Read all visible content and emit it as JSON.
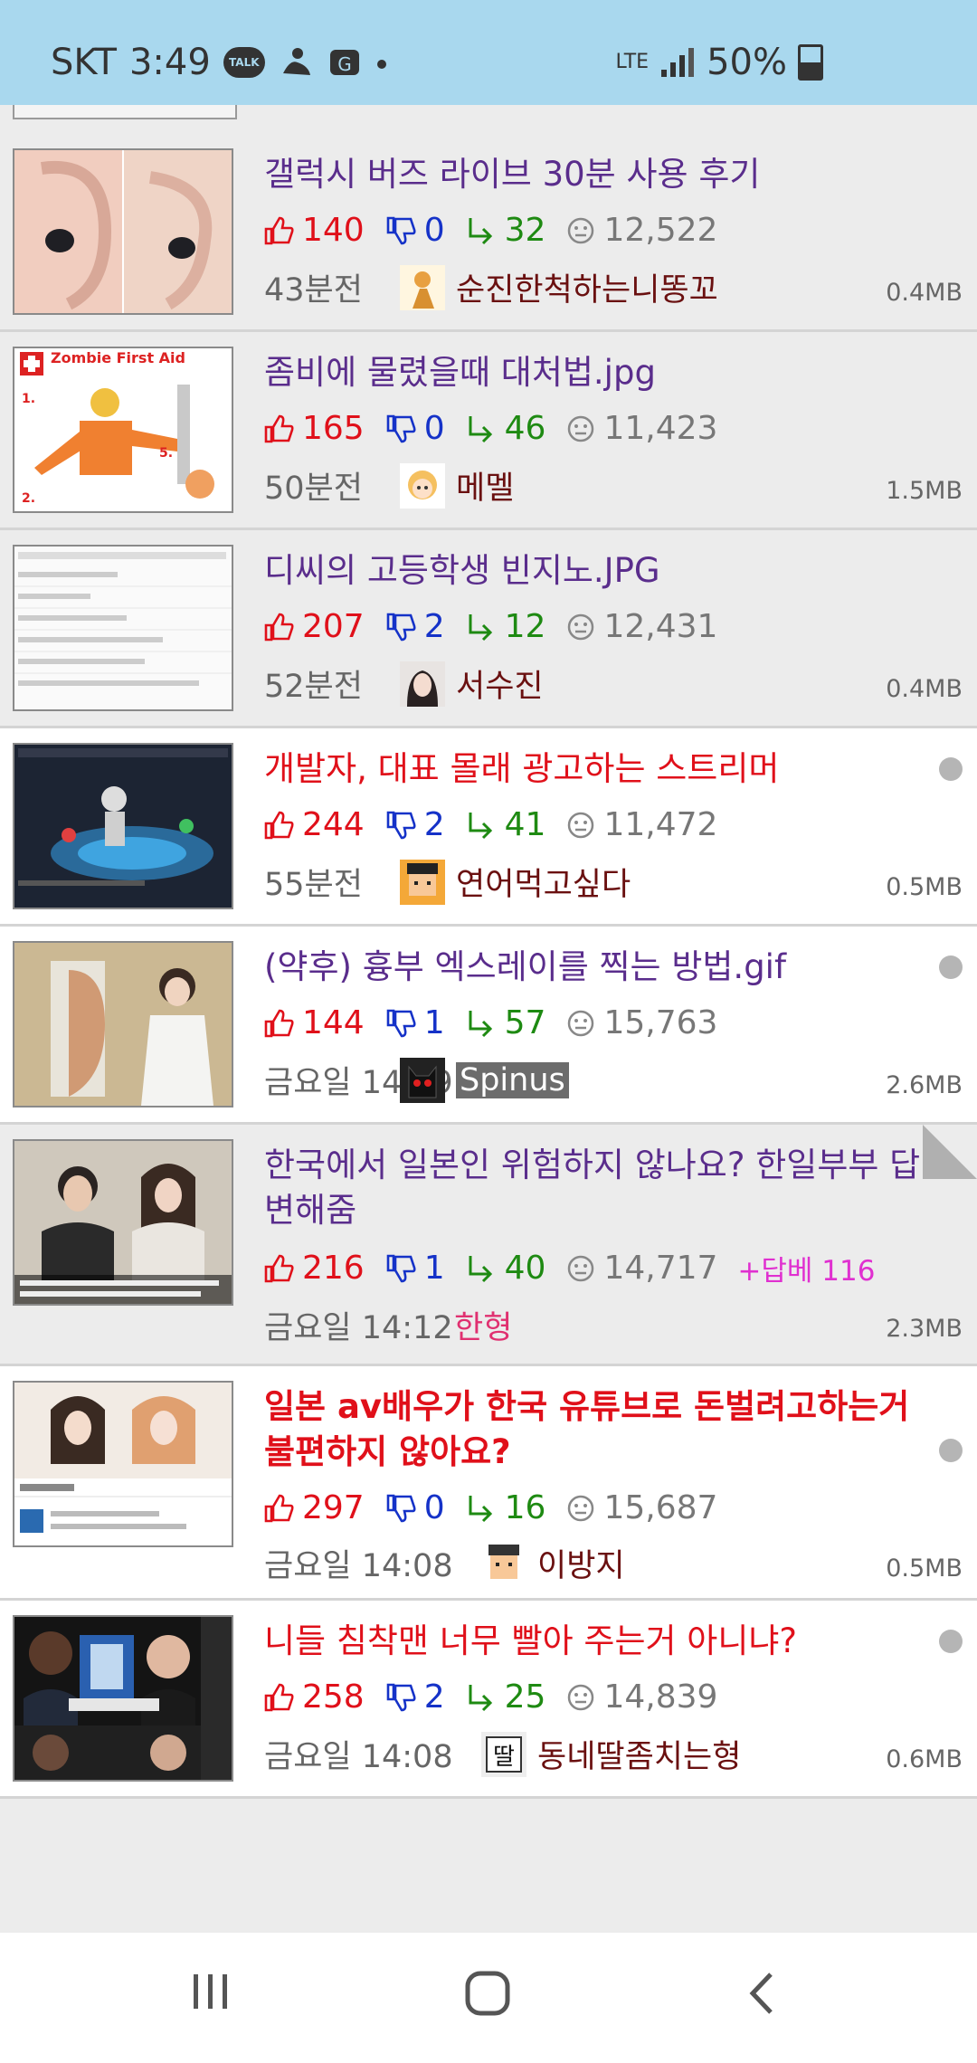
{
  "status": {
    "carrier": "SKT",
    "time": "3:49",
    "talk_label": "TALK",
    "net": "LTE",
    "battery": "50%"
  },
  "posts": [
    {
      "title": "갤럭시 버즈 라이브 30분 사용 후기",
      "title_color": "purple",
      "bold": false,
      "up": "140",
      "down": "0",
      "replies": "32",
      "views": "12,522",
      "bonus": "",
      "time": "43분전",
      "author": "순진한척하는니똥꼬",
      "author_style": "normal",
      "size": "0.4MB",
      "dot": false,
      "bg": "gray"
    },
    {
      "title": "좀비에 물렸을때 대처법.jpg",
      "title_color": "purple",
      "bold": false,
      "up": "165",
      "down": "0",
      "replies": "46",
      "views": "11,423",
      "bonus": "",
      "time": "50분전",
      "author": "메멜",
      "author_style": "normal",
      "size": "1.5MB",
      "dot": false,
      "bg": "gray",
      "thumb_text": "Zombie First Aid"
    },
    {
      "title": "디씨의 고등학생 빈지노.JPG",
      "title_color": "purple",
      "bold": false,
      "up": "207",
      "down": "2",
      "replies": "12",
      "views": "12,431",
      "bonus": "",
      "time": "52분전",
      "author": "서수진",
      "author_style": "normal",
      "size": "0.4MB",
      "dot": false,
      "bg": "gray"
    },
    {
      "title": "개발자, 대표 몰래 광고하는 스트리머",
      "title_color": "red",
      "bold": false,
      "up": "244",
      "down": "2",
      "replies": "41",
      "views": "11,472",
      "bonus": "",
      "time": "55분전",
      "author": "연어먹고싶다",
      "author_style": "normal",
      "size": "0.5MB",
      "dot": true,
      "bg": "white"
    },
    {
      "title": "(약후) 흉부 엑스레이를 찍는 방법.gif",
      "title_color": "purple",
      "bold": false,
      "up": "144",
      "down": "1",
      "replies": "57",
      "views": "15,763",
      "bonus": "",
      "time": "금요일 14:19",
      "author": "Spinus",
      "author_style": "highlight",
      "size": "2.6MB",
      "dot": true,
      "bg": "white"
    },
    {
      "title": "한국에서 일본인 위험하지 않나요? 한일부부 답변해줌",
      "title_color": "purple",
      "bold": false,
      "up": "216",
      "down": "1",
      "replies": "40",
      "views": "14,717",
      "bonus": "+답베 116",
      "time": "금요일 14:12",
      "author": "한형",
      "author_style": "pink",
      "size": "2.3MB",
      "dot": false,
      "bg": "gray"
    },
    {
      "title": "일본 av배우가 한국 유튜브로 돈벌려고하는거 불편하지 않아요?",
      "title_color": "red",
      "bold": true,
      "up": "297",
      "down": "0",
      "replies": "16",
      "views": "15,687",
      "bonus": "",
      "time": "금요일 14:08",
      "author": "이방지",
      "author_style": "normal",
      "size": "0.5MB",
      "dot": true,
      "bg": "white"
    },
    {
      "title": "니들 침착맨 너무 빨아 주는거 아니냐?",
      "title_color": "red",
      "bold": false,
      "up": "258",
      "down": "2",
      "replies": "25",
      "views": "14,839",
      "bonus": "",
      "time": "금요일 14:08",
      "author": "동네딸좀치는형",
      "author_style": "normal",
      "size": "0.6MB",
      "dot": true,
      "bg": "white"
    }
  ],
  "colors": {
    "status_bg": "#a9d8ee",
    "purple_title": "#5a2d8c",
    "red_title": "#e0101a",
    "up": "#e0101a",
    "down": "#1532c8",
    "reply": "#1e8a12"
  },
  "nav": {
    "recent_icon": "recent-apps-icon",
    "home_icon": "home-icon",
    "back_icon": "back-icon"
  }
}
